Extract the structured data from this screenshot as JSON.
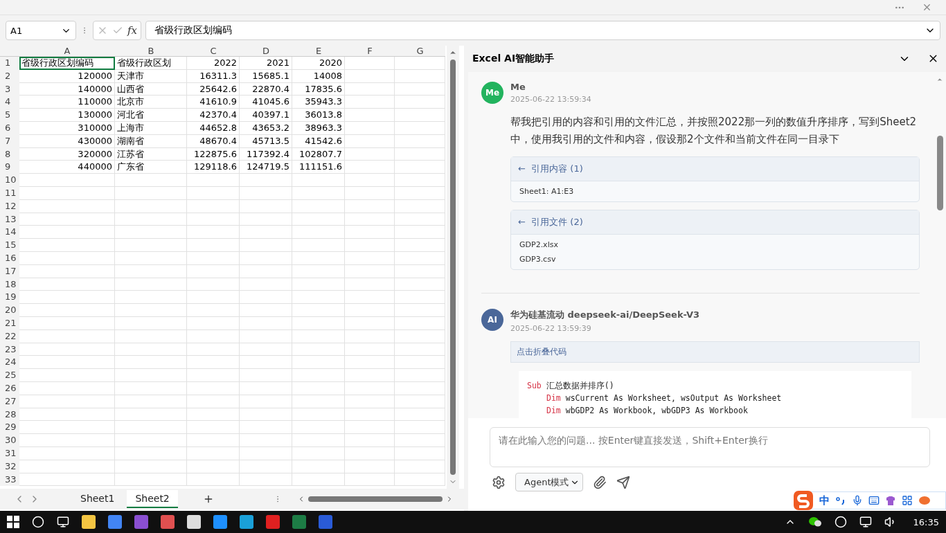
{
  "formula_bar": {
    "name_box": "A1",
    "fx": "fx",
    "formula": "省级行政区划编码"
  },
  "sheet": {
    "columns": [
      "A",
      "B",
      "C",
      "D",
      "E",
      "F",
      "G"
    ],
    "rows": [
      {
        "number": "1",
        "cells": [
          "省级行政区划编码",
          "省级行政区划",
          "2022",
          "2021",
          "2020"
        ]
      },
      {
        "number": "2",
        "cells": [
          "120000",
          "天津市",
          "16311.3",
          "15685.1",
          "14008"
        ]
      },
      {
        "number": "3",
        "cells": [
          "140000",
          "山西省",
          "25642.6",
          "22870.4",
          "17835.6"
        ]
      },
      {
        "number": "4",
        "cells": [
          "110000",
          "北京市",
          "41610.9",
          "41045.6",
          "35943.3"
        ]
      },
      {
        "number": "5",
        "cells": [
          "130000",
          "河北省",
          "42370.4",
          "40397.1",
          "36013.8"
        ]
      },
      {
        "number": "6",
        "cells": [
          "310000",
          "上海市",
          "44652.8",
          "43653.2",
          "38963.3"
        ]
      },
      {
        "number": "7",
        "cells": [
          "430000",
          "湖南省",
          "48670.4",
          "45713.5",
          "41542.6"
        ]
      },
      {
        "number": "8",
        "cells": [
          "320000",
          "江苏省",
          "122875.6",
          "117392.4",
          "102807.7"
        ]
      },
      {
        "number": "9",
        "cells": [
          "440000",
          "广东省",
          "129118.6",
          "124719.5",
          "111151.6"
        ]
      },
      {
        "number": "10"
      },
      {
        "number": "11"
      },
      {
        "number": "12"
      },
      {
        "number": "13"
      },
      {
        "number": "14"
      },
      {
        "number": "15"
      },
      {
        "number": "16"
      },
      {
        "number": "17"
      },
      {
        "number": "18"
      },
      {
        "number": "19"
      },
      {
        "number": "20"
      },
      {
        "number": "21"
      },
      {
        "number": "22"
      },
      {
        "number": "23"
      },
      {
        "number": "24"
      },
      {
        "number": "25"
      },
      {
        "number": "26"
      },
      {
        "number": "27"
      },
      {
        "number": "28"
      },
      {
        "number": "29"
      },
      {
        "number": "30"
      },
      {
        "number": "31"
      },
      {
        "number": "32"
      },
      {
        "number": "33"
      }
    ]
  },
  "sheet_tabs": [
    {
      "label": "Sheet1",
      "selected": false
    },
    {
      "label": "Sheet2",
      "selected": true
    }
  ],
  "assistant": {
    "title": "Excel AI智能助手",
    "messages": [
      {
        "avatar": "Me",
        "color": "#22b35e",
        "sender": "Me",
        "time": "2025-06-22 13:59:34",
        "text": "帮我把引用的内容和引用的文件汇总，并按照2022那一列的数值升序排序，写到Sheet2中，使用我引用的文件和内容，假设那2个文件和当前文件在同一目录下",
        "references": [
          {
            "arrow": "←",
            "title": "引用内容 (1)",
            "items": [
              "Sheet1: A1:E3"
            ]
          },
          {
            "arrow": "←",
            "title": "引用文件 (2)",
            "items": [
              "GDP2.xlsx",
              "GDP3.csv"
            ]
          }
        ]
      },
      {
        "avatar": "AI",
        "color": "#4a6799",
        "sender": "华为硅基流动 deepseek-ai/DeepSeek-V3",
        "time": "2025-06-22 13:59:39",
        "code_toggle": "点击折叠代码",
        "code": [
          {
            "keyword": "Sub",
            "text": "汇总数据并排序()",
            "indented": false
          },
          {
            "keyword": "Dim",
            "text": "wsCurrent As Worksheet, wsOutput As Worksheet",
            "indented": true
          },
          {
            "keyword": "Dim",
            "text": "wbGDP2 As Workbook, wbGDP3 As Workbook",
            "indented": true
          }
        ]
      }
    ],
    "input": {
      "placeholder": "请在此输入您的问题... 按Enter键直接发送，Shift+Enter换行"
    },
    "mode": "Agent模式"
  },
  "ime": {
    "label": "中"
  },
  "taskbar": {
    "time": "16:35"
  }
}
